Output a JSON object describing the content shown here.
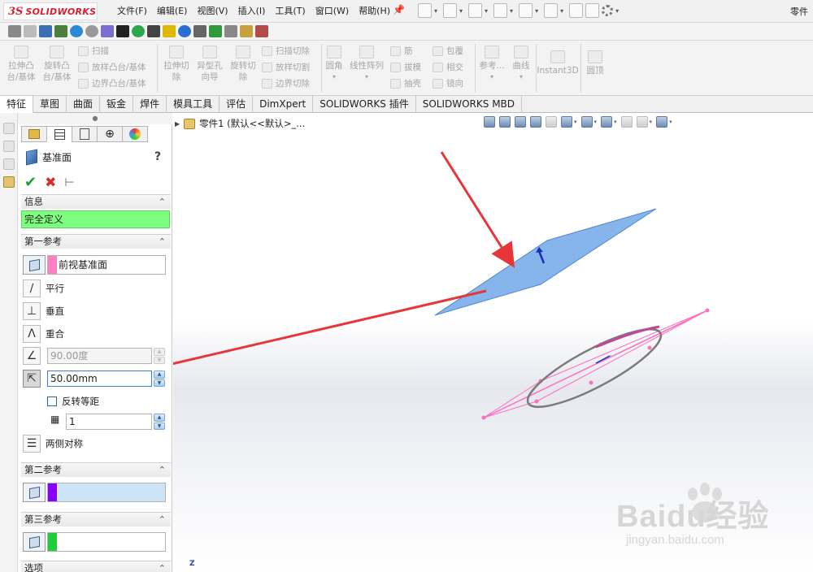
{
  "app": {
    "logo_ds": "3S",
    "logo_text": "SOLIDWORKS",
    "title_right": "零件"
  },
  "menu": [
    "文件(F)",
    "编辑(E)",
    "视图(V)",
    "插入(I)",
    "工具(T)",
    "窗口(W)",
    "帮助(H)"
  ],
  "commands": {
    "extrude_boss": "拉伸凸\n台/基体",
    "revolve_boss": "旋转凸\n台/基体",
    "sweep": "扫描",
    "loft_boss": "放样凸台/基体",
    "boundary_boss": "边界凸台/基体",
    "extrude_cut": "拉伸切\n除",
    "hole_wizard": "异型孔\n向导",
    "revolve_cut": "旋转切\n除",
    "sweep_cut": "扫描切除",
    "loft_cut": "放样切割",
    "boundary_cut": "边界切除",
    "fillet": "圆角",
    "linear_pattern": "线性阵列",
    "rib": "筋",
    "draft": "拔模",
    "shell": "抽壳",
    "wrap": "包覆",
    "intersect": "相交",
    "mirror": "镜向",
    "reference": "参考...",
    "curves": "曲线",
    "instant3d": "Instant3D",
    "dome": "圆顶"
  },
  "tabs": [
    "特征",
    "草图",
    "曲面",
    "钣金",
    "焊件",
    "模具工具",
    "评估",
    "DimXpert",
    "SOLIDWORKS 插件",
    "SOLIDWORKS MBD"
  ],
  "property_manager": {
    "title": "基准面",
    "help": "?",
    "sections": {
      "info": {
        "label": "信息",
        "status": "完全定义"
      },
      "first_ref": {
        "label": "第一参考",
        "reference": "前视基准面",
        "parallel": "平行",
        "perpendicular": "垂直",
        "coincident": "重合",
        "angle": "90.00度",
        "distance": "50.00mm",
        "flip_offset": "反转等距",
        "count": "1",
        "mid_plane": "两侧对称"
      },
      "second_ref": {
        "label": "第二参考",
        "reference": ""
      },
      "third_ref": {
        "label": "第三参考",
        "reference": ""
      },
      "options": {
        "label": "选项"
      }
    },
    "colors": {
      "first": "#ff7fc0",
      "second": "#8a00ff",
      "third": "#1fcc3a"
    }
  },
  "viewport": {
    "tree_label": "零件1  (默认<<默认>_...",
    "triad_axis": "Z",
    "watermark_main": "Baidu经验",
    "watermark_sub": "jingyan.baidu.com"
  }
}
